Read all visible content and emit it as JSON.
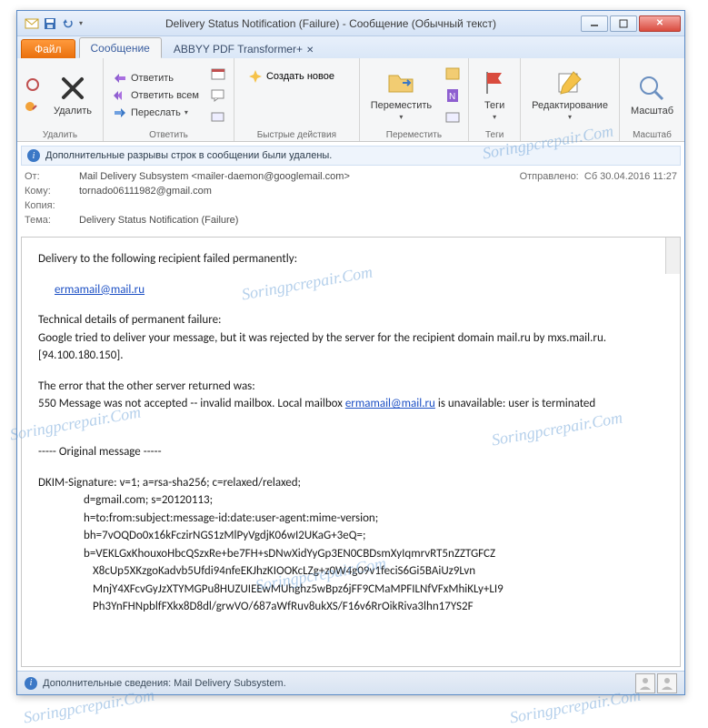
{
  "window_title": "Delivery Status Notification (Failure)  -  Сообщение (Обычный текст)",
  "tabs": {
    "file": "Файл",
    "message": "Сообщение",
    "abbyy": "ABBYY PDF Transformer+"
  },
  "ribbon": {
    "delete": {
      "btn": "Удалить",
      "group": "Удалить"
    },
    "respond": {
      "reply": "Ответить",
      "reply_all": "Ответить всем",
      "forward": "Переслать",
      "group": "Ответить"
    },
    "quick": {
      "create": "Создать новое",
      "group": "Быстрые действия"
    },
    "move": {
      "btn": "Переместить",
      "group": "Переместить"
    },
    "tags": {
      "btn": "Теги",
      "group": "Теги"
    },
    "edit": {
      "btn": "Редактирование"
    },
    "zoom": {
      "btn": "Масштаб",
      "group": "Масштаб"
    }
  },
  "infobar": "Дополнительные разрывы строк в сообщении были удалены.",
  "headers": {
    "from_k": "От:",
    "from_v": "Mail Delivery Subsystem <mailer-daemon@googlemail.com>",
    "sent_k": "Отправлено:",
    "sent_v": "Сб 30.04.2016 11:27",
    "to_k": "Кому:",
    "to_v": "tornado06111982@gmail.com",
    "cc_k": "Копия:",
    "subj_k": "Тема:",
    "subj_v": "Delivery Status Notification (Failure)"
  },
  "body": {
    "l1": "Delivery to the following recipient failed permanently:",
    "email1": "ermamail@mail.ru",
    "tech_h": "Technical details of permanent failure:",
    "tech1": "Google tried to deliver your message, but it was rejected by the server for the recipient domain mail.ru by mxs.mail.ru. [94.100.180.150].",
    "err_h": "The error that the other server returned was:",
    "err1a": "550 Message was not accepted -- invalid mailbox.  Local mailbox ",
    "email2": "ermamail@mail.ru",
    "err1b": " is unavailable: user is terminated",
    "orig": "----- Original message -----",
    "dkim1": "DKIM-Signature: v=1; a=rsa-sha256; c=relaxed/relaxed;",
    "dkim2": "d=gmail.com; s=20120113;",
    "dkim3": "h=to:from:subject:message-id:date:user-agent:mime-version;",
    "dkim4": "bh=7vOQDo0x16kFczirNGS1zMlPyVgdjK06wI2UKaG+3eQ=;",
    "dkim5": "b=VEKLGxKhouxoHbcQSzxRe+be7FH+sDNwXidYyGp3EN0CBDsmXyIqmrvRT5nZZTGFCZ",
    "dkim6": "X8cUp5XKzgoKadvb5Ufdi94nfeEKJhzKIOOKcLZg+z0W4g09v1feciS6Gi5BAiUz9Lvn",
    "dkim7": "MnjY4XFcvGyJzXTYMGPu8HUZUIEEwMUhghz5wBpz6jFF9CMaMPFILNfVFxMhiKLy+LI9",
    "dkim8": "Ph3YnFHNpblfFXkx8D8dl/grwVO/687aWfRuv8ukXS/F16v6RrOikRiva3lhn17YS2F"
  },
  "statusbar": "Дополнительные сведения: Mail Delivery Subsystem.",
  "watermark": "Soringpcrepair.Com"
}
